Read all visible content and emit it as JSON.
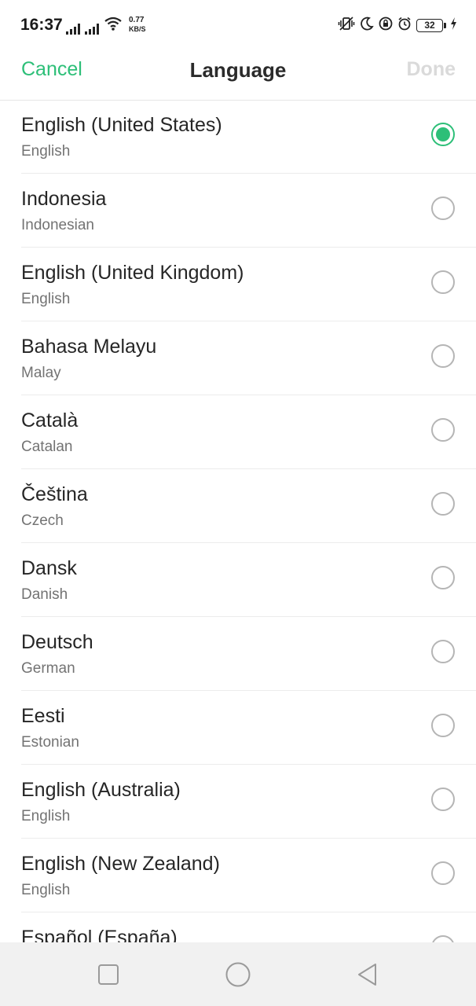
{
  "status_bar": {
    "time": "16:37",
    "net_speed_value": "0.77",
    "net_speed_unit": "KB/S",
    "battery_level": "32"
  },
  "header": {
    "cancel_label": "Cancel",
    "title": "Language",
    "done_label": "Done"
  },
  "colors": {
    "accent": "#2dbf78",
    "done_disabled": "#dadada"
  },
  "languages": [
    {
      "native": "English (United States)",
      "english": "English",
      "selected": true
    },
    {
      "native": "Indonesia",
      "english": "Indonesian",
      "selected": false
    },
    {
      "native": "English (United Kingdom)",
      "english": "English",
      "selected": false
    },
    {
      "native": "Bahasa Melayu",
      "english": "Malay",
      "selected": false
    },
    {
      "native": "Català",
      "english": "Catalan",
      "selected": false
    },
    {
      "native": "Čeština",
      "english": "Czech",
      "selected": false
    },
    {
      "native": "Dansk",
      "english": "Danish",
      "selected": false
    },
    {
      "native": "Deutsch",
      "english": "German",
      "selected": false
    },
    {
      "native": "Eesti",
      "english": "Estonian",
      "selected": false
    },
    {
      "native": "English (Australia)",
      "english": "English",
      "selected": false
    },
    {
      "native": "English (New Zealand)",
      "english": "English",
      "selected": false
    },
    {
      "native": "Español (España)",
      "english": "",
      "selected": false
    }
  ],
  "nav_bar": {
    "icons": [
      "square-recent-apps-icon",
      "circle-home-icon",
      "triangle-back-icon"
    ]
  }
}
